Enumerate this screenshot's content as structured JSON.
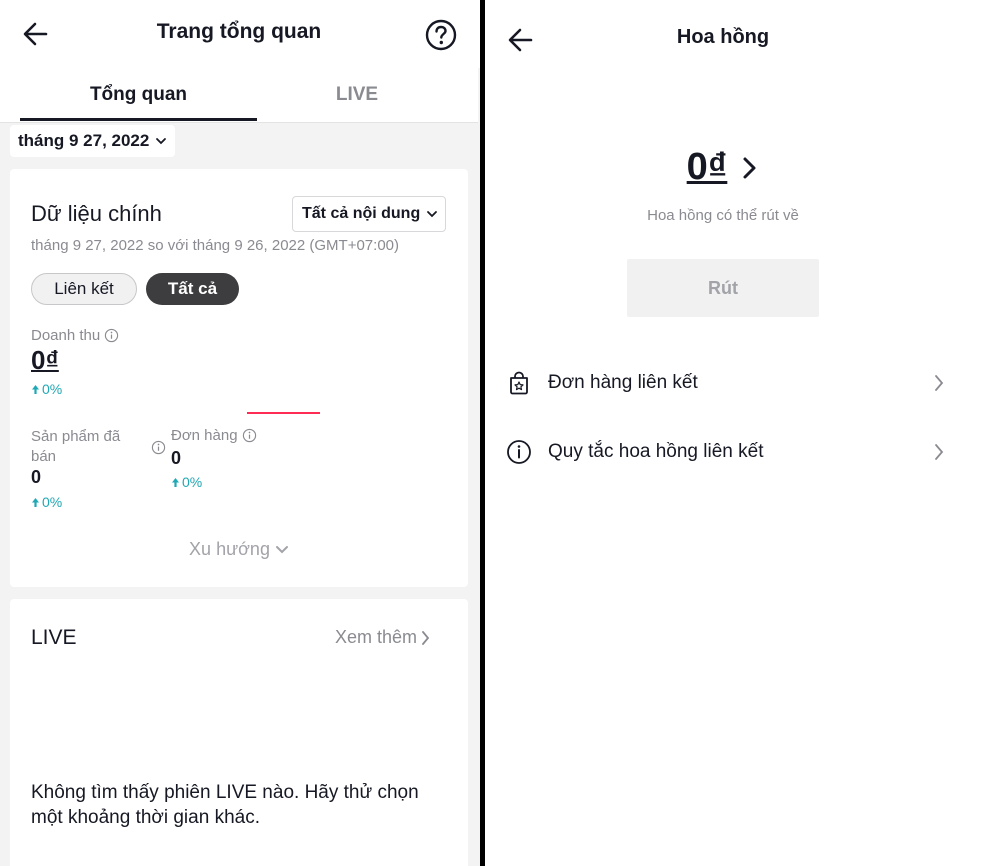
{
  "left": {
    "header": {
      "title": "Trang tổng quan"
    },
    "tabs": [
      {
        "label": "Tổng quan"
      },
      {
        "label": "LIVE"
      }
    ],
    "date_filter": {
      "value": "tháng 9 27, 2022"
    },
    "main_data": {
      "title": "Dữ liệu chính",
      "content_filter": "Tất cả nội dung",
      "compare_text": "tháng 9 27, 2022 so với tháng 9 26, 2022 (GMT+07:00)",
      "pills": [
        {
          "label": "Liên kết"
        },
        {
          "label": "Tất cả"
        }
      ],
      "revenue": {
        "label": "Doanh thu",
        "value": "0₫",
        "change": "0%"
      },
      "products_sold": {
        "label": "Sản phẩm đã bán",
        "value": "0",
        "change": "0%"
      },
      "orders": {
        "label": "Đơn hàng",
        "value": "0",
        "change": "0%"
      },
      "trend_label": "Xu hướng"
    },
    "live_section": {
      "title": "LIVE",
      "see_more": "Xem thêm",
      "empty_message": "Không tìm thấy phiên LIVE nào. Hãy thử chọn một khoảng thời gian khác."
    }
  },
  "right": {
    "header": {
      "title": "Hoa hồng"
    },
    "balance": {
      "value": "0₫",
      "label": "Hoa hồng có thể rút về"
    },
    "withdraw_label": "Rút",
    "menu": [
      {
        "label": "Đơn hàng liên kết",
        "icon": "shopping-bag-icon"
      },
      {
        "label": "Quy tắc hoa hồng liên kết",
        "icon": "info-icon"
      }
    ]
  },
  "colors": {
    "accent_red": "#fe2c55",
    "positive_teal": "#20a8b5",
    "text_primary": "#161823",
    "text_secondary": "#8a8b91"
  }
}
